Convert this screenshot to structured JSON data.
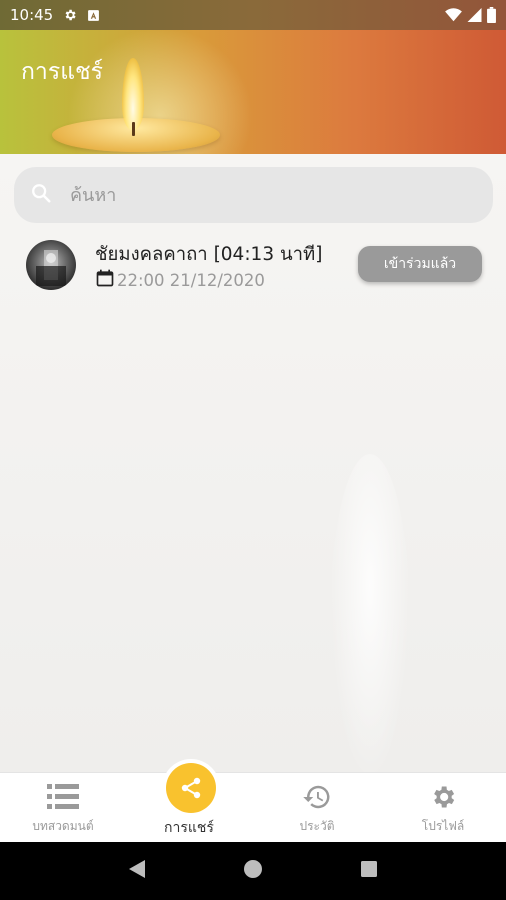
{
  "status_bar": {
    "time": "10:45"
  },
  "header": {
    "title": "การแชร์"
  },
  "search": {
    "placeholder": "ค้นหา"
  },
  "list": [
    {
      "title": "ชัยมงคลคาถา [04:13 นาที]",
      "datetime": "22:00 21/12/2020",
      "button_label": "เข้าร่วมแล้ว"
    }
  ],
  "bottom_nav": {
    "items": [
      {
        "label": "บทสวดมนต์",
        "icon": "list-icon"
      },
      {
        "label": "การแชร์",
        "icon": "share-icon",
        "active": true
      },
      {
        "label": "ประวัติ",
        "icon": "history-icon"
      },
      {
        "label": "โปรไฟล์",
        "icon": "gear-icon"
      }
    ]
  },
  "colors": {
    "accent": "#f9c22e",
    "header_start": "#b8c23c",
    "header_end": "#cf5a35",
    "button_gray": "#9a9a9a"
  }
}
